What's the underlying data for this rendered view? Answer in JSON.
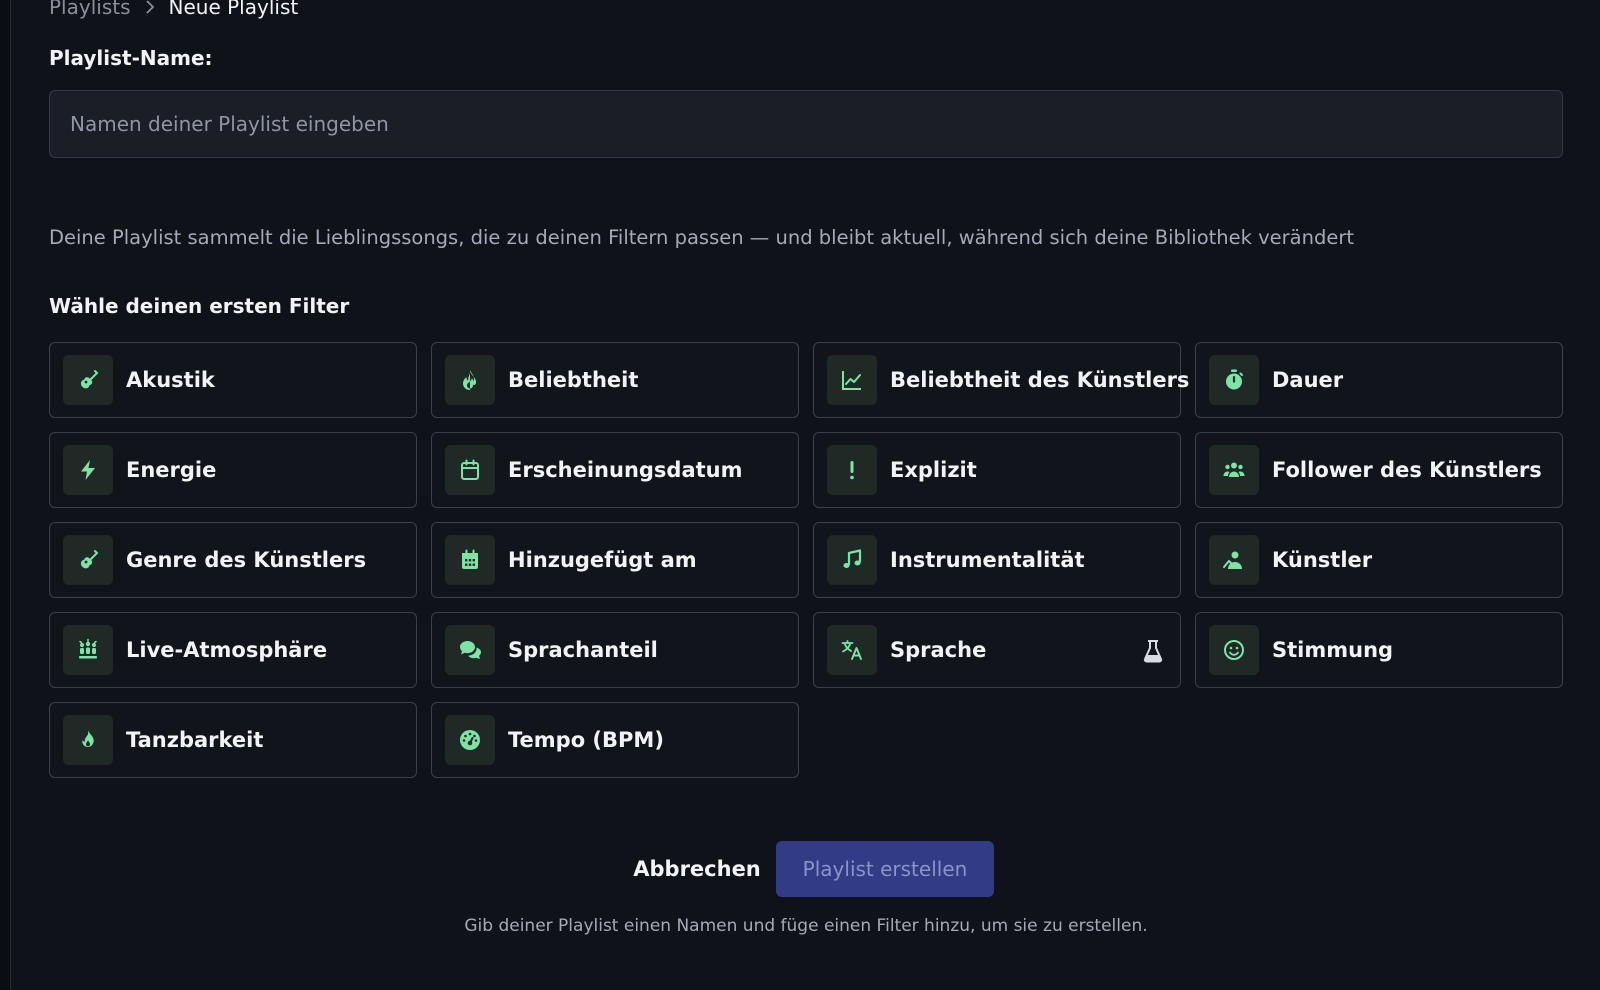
{
  "breadcrumb": {
    "parent": "Playlists",
    "current": "Neue Playlist"
  },
  "form": {
    "name_label": "Playlist-Name:",
    "name_placeholder": "Namen deiner Playlist eingeben",
    "name_value": ""
  },
  "description": "Deine Playlist sammelt die Lieblingssongs, die zu deinen Filtern passen — und bleibt aktuell, während sich deine Bibliothek verändert",
  "filters_title": "Wähle deinen ersten Filter",
  "filters": [
    {
      "label": "Akustik",
      "icon": "guitar-icon"
    },
    {
      "label": "Beliebtheit",
      "icon": "flame-icon"
    },
    {
      "label": "Beliebtheit des Künstlers",
      "icon": "chart-line-icon"
    },
    {
      "label": "Dauer",
      "icon": "stopwatch-icon"
    },
    {
      "label": "Energie",
      "icon": "bolt-icon"
    },
    {
      "label": "Erscheinungsdatum",
      "icon": "calendar-icon"
    },
    {
      "label": "Explizit",
      "icon": "exclamation-icon"
    },
    {
      "label": "Follower des Künstlers",
      "icon": "users-icon"
    },
    {
      "label": "Genre des Künstlers",
      "icon": "guitar-icon"
    },
    {
      "label": "Hinzugefügt am",
      "icon": "calendar-days-icon"
    },
    {
      "label": "Instrumentalität",
      "icon": "music-note-icon"
    },
    {
      "label": "Künstler",
      "icon": "person-chalkboard-icon"
    },
    {
      "label": "Live-Atmosphäre",
      "icon": "crowd-icon"
    },
    {
      "label": "Sprachanteil",
      "icon": "comments-icon"
    },
    {
      "label": "Sprache",
      "icon": "language-icon",
      "beta_icon": "flask-icon"
    },
    {
      "label": "Stimmung",
      "icon": "smile-icon"
    },
    {
      "label": "Tanzbarkeit",
      "icon": "fire-icon"
    },
    {
      "label": "Tempo (BPM)",
      "icon": "gauge-icon"
    }
  ],
  "actions": {
    "cancel_label": "Abbrechen",
    "create_label": "Playlist erstellen"
  },
  "hint": "Gib deiner Playlist einen Namen und füge einen Filter hinzu, um sie zu erstellen.",
  "colors": {
    "background": "#10121a",
    "accent_icon": "#7fe3a6",
    "primary_button": "#313b86"
  }
}
